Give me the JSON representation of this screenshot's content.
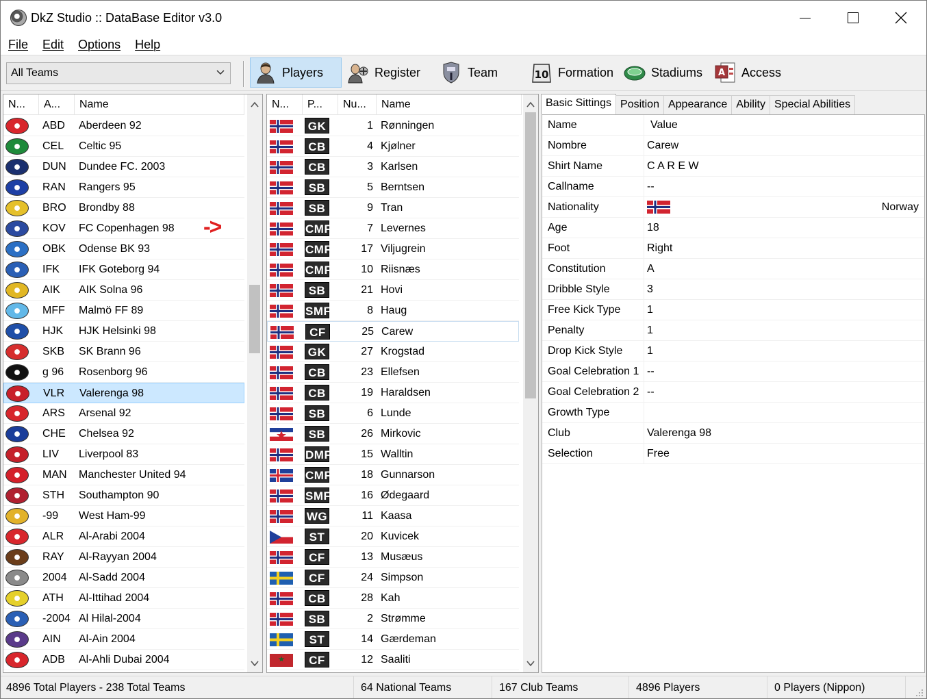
{
  "window": {
    "title": "DkZ Studio :: DataBase Editor v3.0"
  },
  "menu": [
    {
      "label": "File"
    },
    {
      "label": "Edit"
    },
    {
      "label": "Options"
    },
    {
      "label": "Help"
    }
  ],
  "toolbar": {
    "team_filter": "All Teams",
    "buttons": [
      {
        "label": "Players",
        "icon": "player-icon"
      },
      {
        "label": "Register",
        "icon": "register-icon"
      },
      {
        "label": "Team",
        "icon": "team-icon"
      },
      {
        "label": "Formation",
        "icon": "formation-icon"
      },
      {
        "label": "Stadiums",
        "icon": "stadium-icon"
      },
      {
        "label": "Access",
        "icon": "access-icon"
      }
    ]
  },
  "teams_table": {
    "headers": [
      "N...",
      "A...",
      "Name"
    ],
    "rows": [
      {
        "abbr": "ABD",
        "name": "Aberdeen 92",
        "color": "#d8262c"
      },
      {
        "abbr": "CEL",
        "name": "Celtic 95",
        "color": "#1e8a3a"
      },
      {
        "abbr": "DUN",
        "name": "Dundee FC. 2003",
        "color": "#1a2f6e"
      },
      {
        "abbr": "RAN",
        "name": "Rangers 95",
        "color": "#1d3fa5"
      },
      {
        "abbr": "BRO",
        "name": "Brondby 88",
        "color": "#e5c02a"
      },
      {
        "abbr": "KOV",
        "name": "FC Copenhagen 98",
        "color": "#2b4aa0"
      },
      {
        "abbr": "OBK",
        "name": "Odense BK 93",
        "color": "#2b6fc4"
      },
      {
        "abbr": "IFK",
        "name": "IFK Goteborg 94",
        "color": "#2a5fb5"
      },
      {
        "abbr": "AIK",
        "name": "AIK Solna 96",
        "color": "#e1b724"
      },
      {
        "abbr": "MFF",
        "name": "Malmö FF 89",
        "color": "#62b8e8"
      },
      {
        "abbr": "HJK",
        "name": "HJK Helsinki 98",
        "color": "#1f4fa8"
      },
      {
        "abbr": "SKB",
        "name": "SK Brann 96",
        "color": "#d62e2e"
      },
      {
        "abbr": "g 96",
        "name": "Rosenborg 96",
        "color": "#111111"
      },
      {
        "abbr": "VLR",
        "name": "Valerenga 98",
        "color": "#c8202a"
      },
      {
        "abbr": "ARS",
        "name": "Arsenal 92",
        "color": "#d7262c"
      },
      {
        "abbr": "CHE",
        "name": "Chelsea 92",
        "color": "#1a3d9a"
      },
      {
        "abbr": "LIV",
        "name": "Liverpool 83",
        "color": "#c5202a"
      },
      {
        "abbr": "MAN",
        "name": "Manchester United 94",
        "color": "#d4202a"
      },
      {
        "abbr": "STH",
        "name": "Southampton 90",
        "color": "#b02030"
      },
      {
        "abbr": "-99",
        "name": "West Ham-99",
        "color": "#e2b22a"
      },
      {
        "abbr": "ALR",
        "name": "Al-Arabi 2004",
        "color": "#d8262c"
      },
      {
        "abbr": "RAY",
        "name": "Al-Rayyan 2004",
        "color": "#6b3d1a"
      },
      {
        "abbr": "2004",
        "name": "Al-Sadd 2004",
        "color": "#8a8a8a"
      },
      {
        "abbr": "ATH",
        "name": "Al-Ittihad 2004",
        "color": "#e5d02a"
      },
      {
        "abbr": "-2004",
        "name": "Al Hilal-2004",
        "color": "#2a5fb5"
      },
      {
        "abbr": "AIN",
        "name": "Al-Ain 2004",
        "color": "#5a3a8a"
      },
      {
        "abbr": "ADB",
        "name": "Al-Ahli Dubai 2004",
        "color": "#d8262c"
      }
    ],
    "selected_index": 13
  },
  "annotation": {
    "arrow": "->"
  },
  "players_table": {
    "headers": [
      "N...",
      "P...",
      "Nu...",
      "Name"
    ],
    "rows": [
      {
        "flag": "norway",
        "pos": "GK",
        "num": "1",
        "name": "Rønningen"
      },
      {
        "flag": "norway",
        "pos": "CB",
        "num": "4",
        "name": "Kjølner"
      },
      {
        "flag": "norway",
        "pos": "CB",
        "num": "3",
        "name": "Karlsen"
      },
      {
        "flag": "norway",
        "pos": "SB",
        "num": "5",
        "name": "Berntsen"
      },
      {
        "flag": "norway",
        "pos": "SB",
        "num": "9",
        "name": "Tran"
      },
      {
        "flag": "norway",
        "pos": "CMF",
        "num": "7",
        "name": "Levernes"
      },
      {
        "flag": "norway",
        "pos": "CMF",
        "num": "17",
        "name": "Viljugrein"
      },
      {
        "flag": "norway",
        "pos": "CMF",
        "num": "10",
        "name": "Riisnæs"
      },
      {
        "flag": "norway",
        "pos": "SB",
        "num": "21",
        "name": "Hovi"
      },
      {
        "flag": "norway",
        "pos": "SMF",
        "num": "8",
        "name": "Haug"
      },
      {
        "flag": "norway",
        "pos": "CF",
        "num": "25",
        "name": "Carew"
      },
      {
        "flag": "norway",
        "pos": "GK",
        "num": "27",
        "name": "Krogstad"
      },
      {
        "flag": "norway",
        "pos": "CB",
        "num": "23",
        "name": "Ellefsen"
      },
      {
        "flag": "norway",
        "pos": "CB",
        "num": "19",
        "name": "Haraldsen"
      },
      {
        "flag": "norway",
        "pos": "SB",
        "num": "6",
        "name": "Lunde"
      },
      {
        "flag": "yugoslavia",
        "pos": "SB",
        "num": "26",
        "name": "Mirkovic"
      },
      {
        "flag": "norway",
        "pos": "DMF",
        "num": "15",
        "name": "Walltin"
      },
      {
        "flag": "iceland",
        "pos": "CMF",
        "num": "18",
        "name": "Gunnarson"
      },
      {
        "flag": "norway",
        "pos": "SMF",
        "num": "16",
        "name": "Ødegaard"
      },
      {
        "flag": "norway",
        "pos": "WG",
        "num": "11",
        "name": "Kaasa"
      },
      {
        "flag": "czech",
        "pos": "ST",
        "num": "20",
        "name": "Kuvicek"
      },
      {
        "flag": "norway",
        "pos": "CF",
        "num": "13",
        "name": "Musæus"
      },
      {
        "flag": "sweden",
        "pos": "CF",
        "num": "24",
        "name": "Simpson"
      },
      {
        "flag": "norway",
        "pos": "CB",
        "num": "28",
        "name": "Kah"
      },
      {
        "flag": "norway",
        "pos": "SB",
        "num": "2",
        "name": "Strømme"
      },
      {
        "flag": "sweden",
        "pos": "ST",
        "num": "14",
        "name": "Gærdeman"
      },
      {
        "flag": "morocco",
        "pos": "CF",
        "num": "12",
        "name": "Saaliti"
      }
    ],
    "highlighted_index": 10
  },
  "details": {
    "tabs": [
      "Basic Sittings",
      "Position",
      "Appearance",
      "Ability",
      "Special Abilities"
    ],
    "active_tab": 0,
    "header": {
      "key": "Name",
      "value": "Value"
    },
    "properties": [
      {
        "key": "Nombre",
        "value": "Carew"
      },
      {
        "key": "Shirt Name",
        "value": "C A R E W"
      },
      {
        "key": "Callname",
        "value": "--"
      },
      {
        "key": "Nationality",
        "value": "Norway",
        "flag": "norway"
      },
      {
        "key": "Age",
        "value": "18"
      },
      {
        "key": "Foot",
        "value": "Right"
      },
      {
        "key": "Constitution",
        "value": "A"
      },
      {
        "key": "Dribble Style",
        "value": "3"
      },
      {
        "key": "Free Kick Type",
        "value": "1"
      },
      {
        "key": "Penalty",
        "value": "1"
      },
      {
        "key": "Drop Kick Style",
        "value": "1"
      },
      {
        "key": "Goal Celebration 1",
        "value": "--"
      },
      {
        "key": "Goal Celebration 2",
        "value": "--"
      },
      {
        "key": "Growth Type",
        "value": ""
      },
      {
        "key": "Club",
        "value": "Valerenga 98"
      },
      {
        "key": "Selection",
        "value": "Free"
      }
    ]
  },
  "status": {
    "totals": "4896 Total Players  -  238 Total Teams",
    "national": "64 National Teams",
    "club": "167 Club Teams",
    "players": "4896 Players",
    "nippon": "0 Players (Nippon)"
  }
}
